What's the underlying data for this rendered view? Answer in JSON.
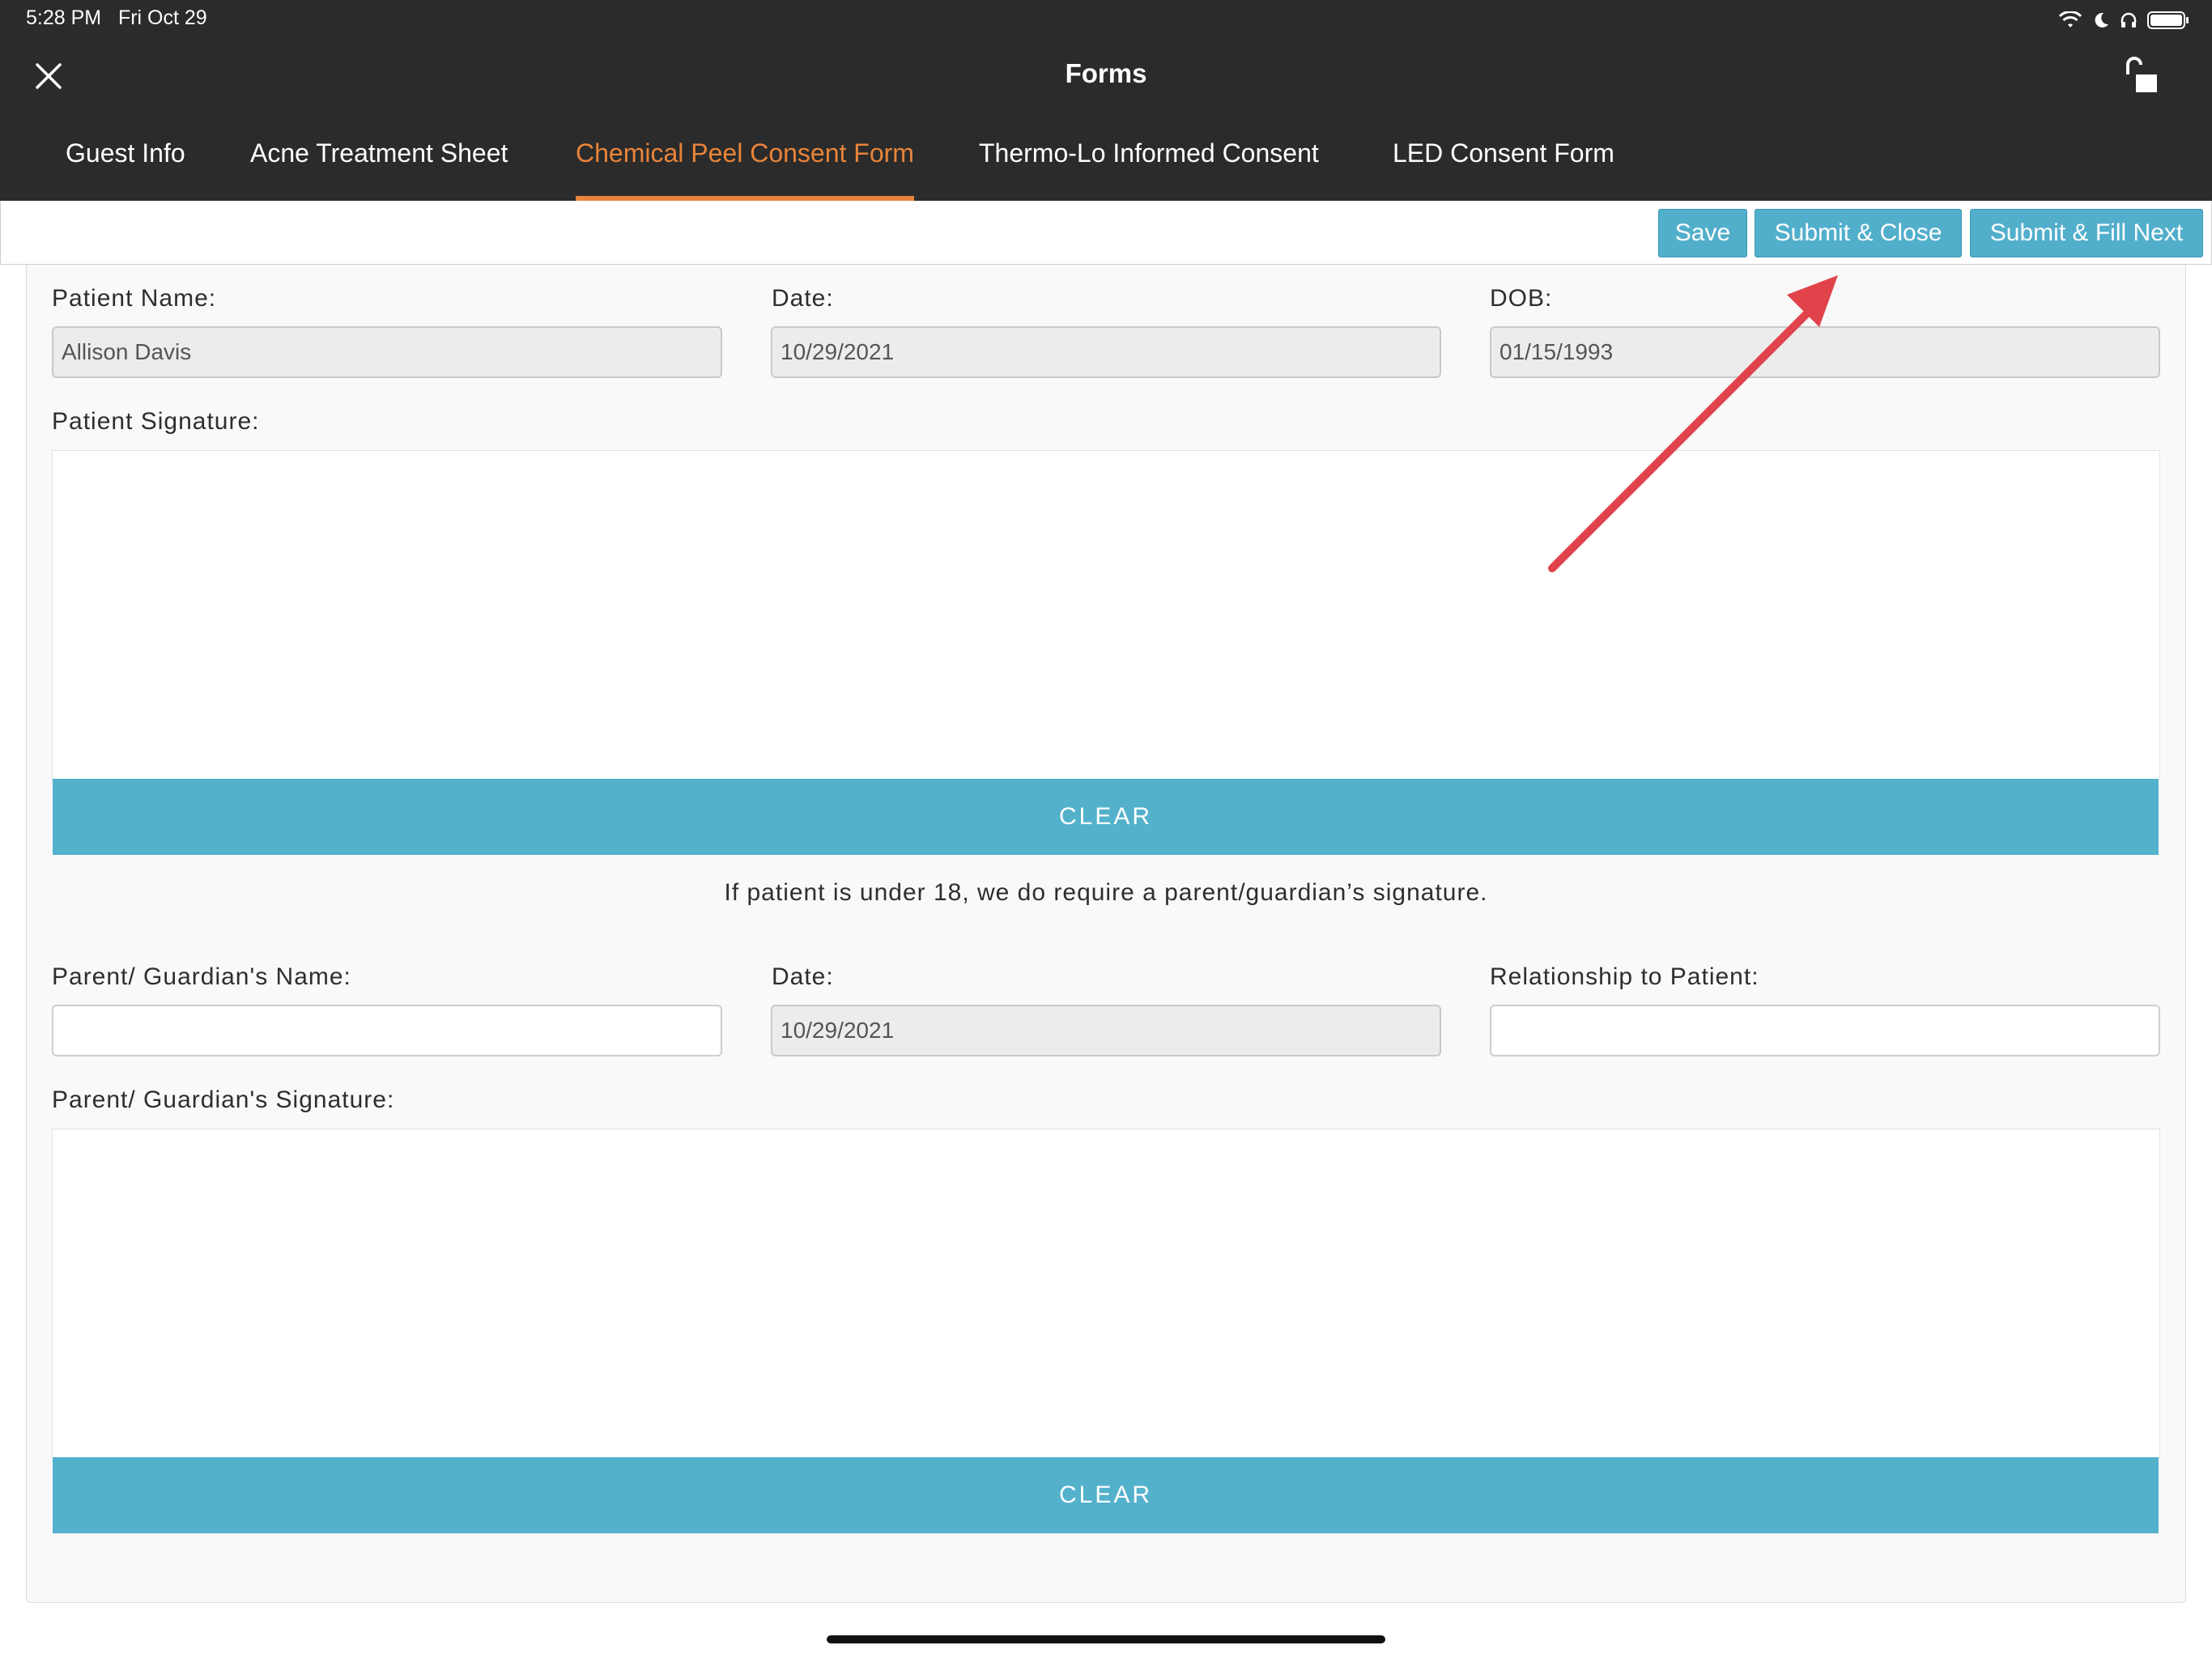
{
  "status_bar": {
    "time": "5:28 PM",
    "date": "Fri Oct 29"
  },
  "header": {
    "title": "Forms"
  },
  "tabs": [
    {
      "label": "Guest Info",
      "active": false
    },
    {
      "label": "Acne Treatment Sheet",
      "active": false
    },
    {
      "label": "Chemical Peel Consent Form",
      "active": true
    },
    {
      "label": "Thermo-Lo Informed Consent",
      "active": false
    },
    {
      "label": "LED Consent Form",
      "active": false
    }
  ],
  "toolbar": {
    "save": "Save",
    "submit_close": "Submit & Close",
    "submit_fill_next": "Submit & Fill Next"
  },
  "form": {
    "patient_name_label": "Patient Name:",
    "patient_name_value": "Allison Davis",
    "date_label": "Date:",
    "date_value": "10/29/2021",
    "dob_label": "DOB:",
    "dob_value": "01/15/1993",
    "patient_signature_label": "Patient Signature:",
    "clear_label": "CLEAR",
    "under18_note": "If patient is under 18, we do require a parent/guardian’s signature.",
    "guardian_name_label": "Parent/ Guardian's Name:",
    "guardian_name_value": "",
    "guardian_date_label": "Date:",
    "guardian_date_value": "10/29/2021",
    "relationship_label": "Relationship to Patient:",
    "relationship_value": "",
    "guardian_signature_label": "Parent/ Guardian's Signature:",
    "clear_label_2": "CLEAR"
  },
  "colors": {
    "header_bg": "#2b2b2b",
    "accent_orange": "#e9843a",
    "button_blue": "#52afcb",
    "annotation_red": "#e0434a"
  }
}
